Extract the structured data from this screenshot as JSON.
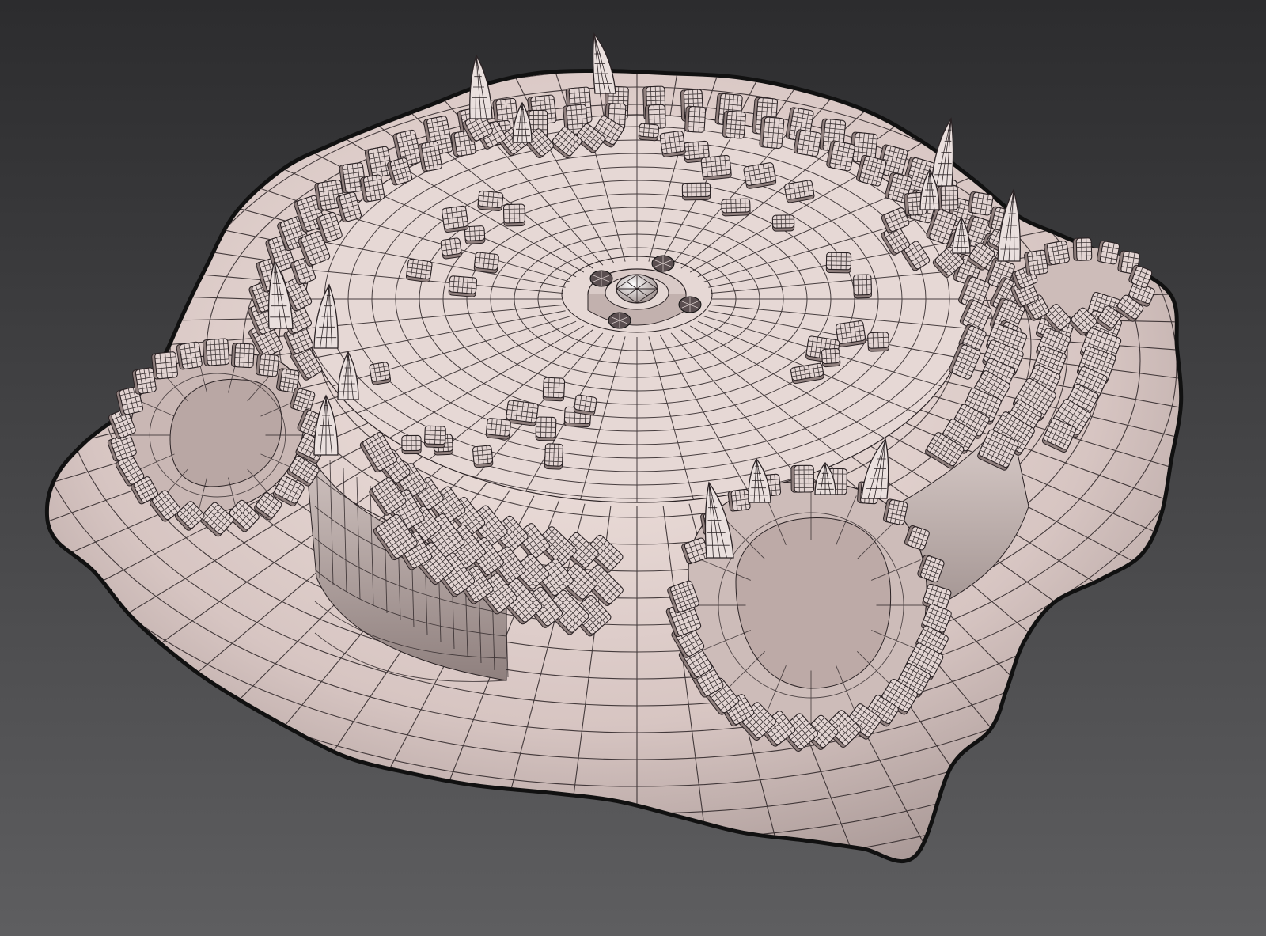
{
  "viewport": {
    "background_top": "#2c2c2e",
    "background_bottom": "#5e5e60"
  },
  "model": {
    "surface_light": "#f1e4e0",
    "surface_mid": "#d7c5c2",
    "surface_shadow": "#9c8c8a",
    "silhouette_color": "#111111",
    "wire_color": "#2a2224",
    "stone_color": "#e2d4d2",
    "spike_color": "#eae0de"
  }
}
